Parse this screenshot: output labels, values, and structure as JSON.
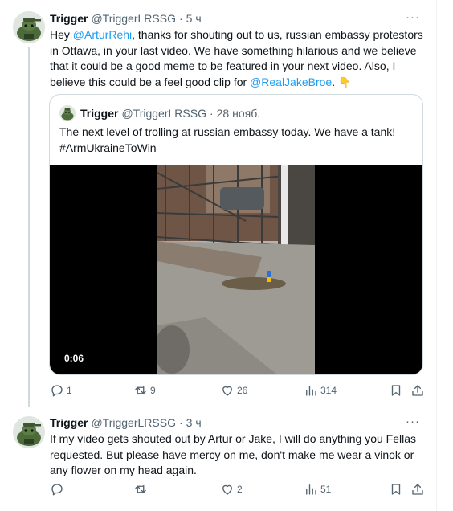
{
  "tweets": [
    {
      "name": "Trigger",
      "handle": "@TriggerLRSSG",
      "sep": "·",
      "time": "5 ч",
      "more": "···",
      "text_parts": {
        "p1": "Hey ",
        "m1": "@ArturRehi",
        "p2": ", thanks for shouting out to us, russian embassy protestors in Ottawa, in your last video. We have something hilarious and we believe that it could be a good meme to be featured in your next video. Also, I believe this could be a feel good clip for ",
        "m2": "@RealJakeBroe",
        "p3": ". ",
        "emoji": "👇"
      },
      "quote": {
        "name": "Trigger",
        "handle": "@TriggerLRSSG",
        "sep": "·",
        "date": "28 нояб.",
        "text": "The next level of trolling at russian embassy today. We have a tank! #ArmUkraineToWin",
        "video_time": "0:06"
      },
      "stats": {
        "replies": "1",
        "retweets": "9",
        "likes": "26",
        "views": "314"
      }
    },
    {
      "name": "Trigger",
      "handle": "@TriggerLRSSG",
      "sep": "·",
      "time": "3 ч",
      "more": "···",
      "text": "If my video gets shouted out by Artur or Jake, I will do anything you Fellas requested. But please have mercy on me, don't make me wear a vinok or any flower on my head again.",
      "stats": {
        "replies": "",
        "retweets": "",
        "likes": "2",
        "views": "51"
      }
    }
  ],
  "icons": [
    "avatar-image",
    "more-icon",
    "reply-icon",
    "retweet-icon",
    "like-icon",
    "views-icon",
    "bookmark-icon",
    "share-icon",
    "point-down-emoji"
  ],
  "colors": {
    "link": "#1d9bf0",
    "text": "#0f1419",
    "secondary": "#536471",
    "border": "#cfd9de",
    "thread_line": "#cfd9de"
  }
}
